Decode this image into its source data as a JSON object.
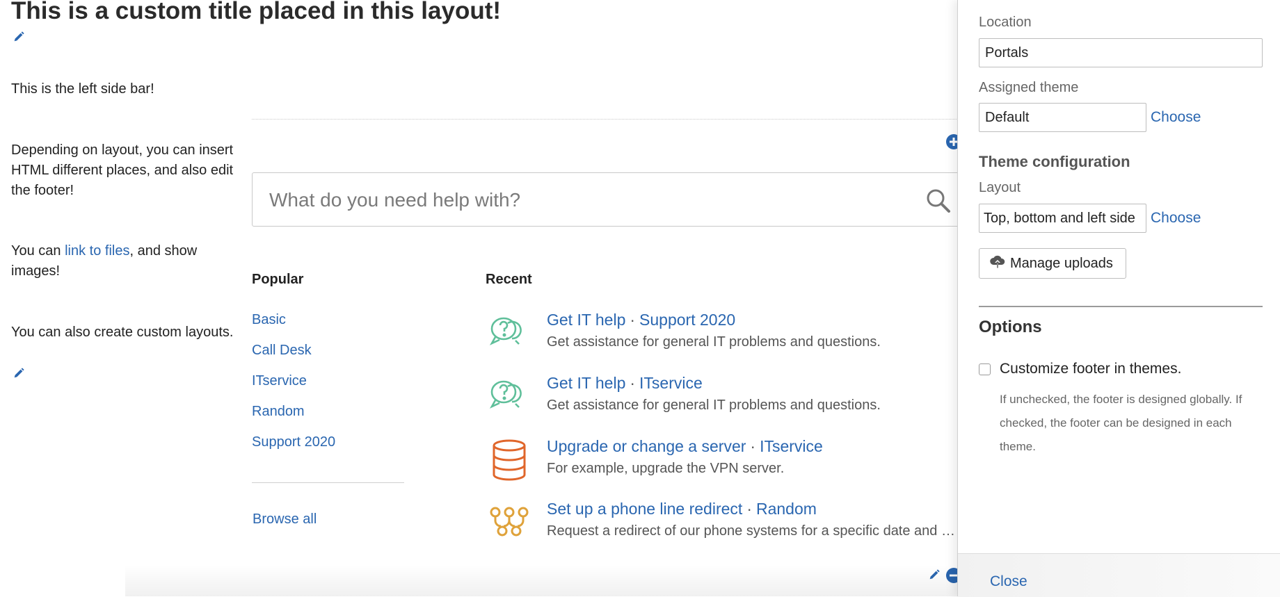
{
  "page": {
    "title": "This is a custom title placed in this layout!"
  },
  "sidebar": {
    "para1": "This is the left side bar!",
    "para2": "Depending on layout, you can insert HTML different places, and also edit the footer!",
    "para3_before": "You can ",
    "para3_link": "link to files",
    "para3_after": ", and show images!",
    "para4": "You can also create custom layouts."
  },
  "search": {
    "placeholder": "What do you need help with?"
  },
  "popular": {
    "heading": "Popular",
    "items": [
      "Basic",
      "Call Desk",
      "ITservice",
      "Random",
      "Support 2020"
    ],
    "browse_all": "Browse all"
  },
  "recent": {
    "heading": "Recent",
    "items": [
      {
        "name": "Get IT help",
        "project": "Support 2020",
        "description": "Get assistance for general IT problems and questions.",
        "icon": "chat-question-icon",
        "color": "#5fbf9a"
      },
      {
        "name": "Get IT help",
        "project": "ITservice",
        "description": "Get assistance for general IT problems and questions.",
        "icon": "chat-question-icon",
        "color": "#5fbf9a"
      },
      {
        "name": "Upgrade or change a server",
        "project": "ITservice",
        "description": "For example, upgrade the VPN server.",
        "icon": "database-icon",
        "color": "#e0662b"
      },
      {
        "name": "Set up a phone line redirect",
        "project": "Random",
        "description": "Request a redirect of our phone systems for a specific date and …",
        "icon": "network-icon",
        "color": "#dfa23a"
      }
    ]
  },
  "panel": {
    "location_label": "Location",
    "location_value": "Portals",
    "theme_label": "Assigned theme",
    "theme_value": "Default",
    "choose": "Choose",
    "config_heading": "Theme configuration",
    "layout_label": "Layout",
    "layout_value": "Top, bottom and left side",
    "manage_uploads": "Manage uploads",
    "options_heading": "Options",
    "customize_footer_label": "Customize footer in themes.",
    "customize_footer_checked": false,
    "customize_footer_help": "If unchecked, the footer is designed globally. If checked, the footer can be designed in each theme.",
    "close": "Close"
  },
  "colors": {
    "link": "#2a66b0",
    "chat_icon": "#5fbf9a",
    "database_icon": "#e0662b",
    "network_icon": "#dfa23a"
  }
}
